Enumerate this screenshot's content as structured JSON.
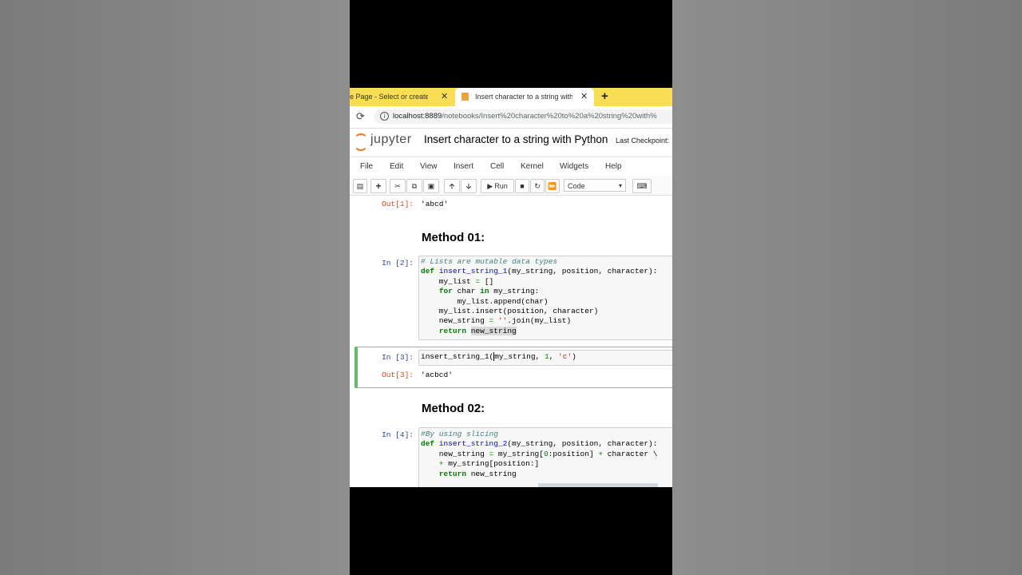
{
  "tabs": [
    {
      "title": "e Page - Select or create a n",
      "close": "✕"
    },
    {
      "title": "Insert character to a string with P",
      "close": "✕"
    }
  ],
  "new_tab": "+",
  "address": {
    "host": "localhost:8889",
    "path": "/notebooks/Insert%20character%20to%20a%20string%20with%"
  },
  "jupyter": {
    "brand": "jupyter",
    "notebook_title": "Insert character to a string with Python",
    "checkpoint": "Last Checkpoint:"
  },
  "menu": [
    "File",
    "Edit",
    "View",
    "Insert",
    "Cell",
    "Kernel",
    "Widgets",
    "Help"
  ],
  "toolbar": {
    "run_label": "Run",
    "cell_type": "Code"
  },
  "cells": {
    "out1_prompt": "Out[1]:",
    "out1_value": "'abcd'",
    "heading1": "Method 01:",
    "in2_prompt": "In [2]:",
    "in3_prompt": "In [3]:",
    "out3_prompt": "Out[3]:",
    "out3_value": "'acbcd'",
    "heading2": "Method 02:",
    "in4_prompt": "In [4]:"
  },
  "colors": {
    "tab_bar": "#f9dd55",
    "selected_cell_border": "#66bb6a",
    "in_prompt": "#303f9f",
    "out_prompt": "#d84315"
  }
}
